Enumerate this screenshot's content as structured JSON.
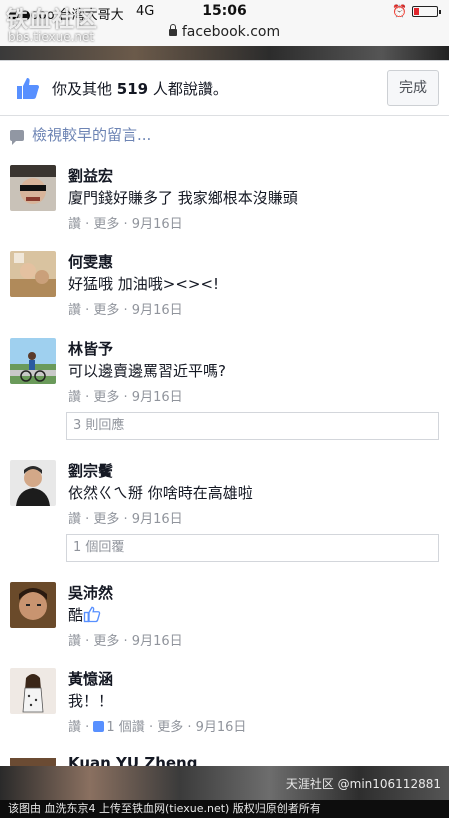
{
  "status_bar": {
    "carrier": "●●ooo 台湾大哥大",
    "network": "4G",
    "time": "15:06",
    "alarm_icon": "alarm-clock-icon"
  },
  "url_bar": {
    "domain": "facebook.com"
  },
  "likes": {
    "prefix": "你及其他 ",
    "count": "519",
    "suffix": " 人都說讚。",
    "done_label": "完成"
  },
  "view_previous": "檢視較早的留言...",
  "comments": [
    {
      "name": "劉益宏",
      "text": "廈門錢好賺多了 我家鄉根本沒賺頭",
      "meta": "讚 · 更多 · 9月16日"
    },
    {
      "name": "何雯惠",
      "text": "好猛哦 加油哦><><!",
      "meta": "讚 · 更多 · 9月16日"
    },
    {
      "name": "林皆予",
      "text": "可以邊賣邊罵習近平嗎?",
      "meta": "讚 · 更多 · 9月16日",
      "replies": "3 則回應"
    },
    {
      "name": "劉宗鬢",
      "text": "依然ㄍㄟ掰 你啥時在高雄啦",
      "meta": "讚 · 更多 · 9月16日",
      "replies": "1 個回覆"
    },
    {
      "name": "吳沛然",
      "text": "酷",
      "meta": "讚 · 更多 · 9月16日"
    },
    {
      "name": "黃憶涵",
      "text": "我！！",
      "meta_prefix": "讚 · ",
      "like_count": "1 個讚",
      "meta_suffix": " · 更多 · 9月16日"
    }
  ],
  "partial_comment_name": "Kuan YU Zheng",
  "watermarks": {
    "top_logo": "铁血社区",
    "top_url": "bbs.tiexue.net",
    "bottom_right": "天涯社区 @min106112881",
    "footer": "该图由 血洗东京4 上传至铁血网(tiexue.net) 版权归原创者所有"
  },
  "colors": {
    "facebook_blue": "#5890ff",
    "meta_gray": "#90949c",
    "link_blue": "#6d84b4"
  }
}
